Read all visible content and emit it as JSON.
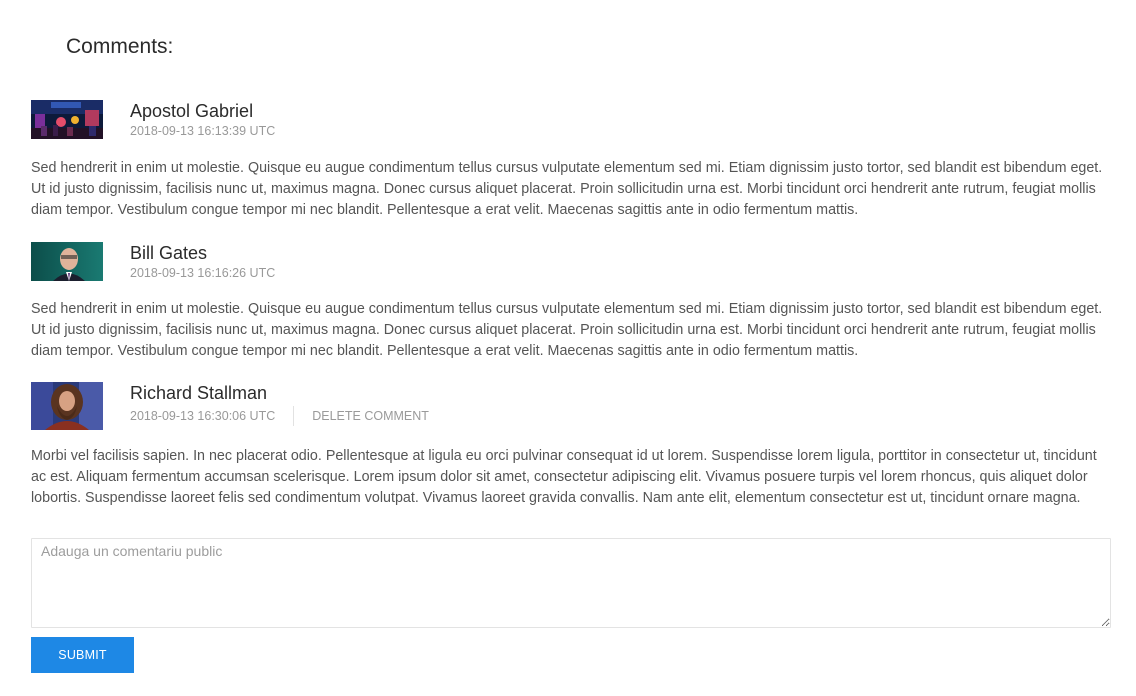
{
  "page": {
    "title": "Comments:"
  },
  "comments": [
    {
      "author": "Apostol Gabriel",
      "timestamp": "2018-09-13 16:13:39 UTC",
      "body": "Sed hendrerit in enim ut molestie. Quisque eu augue condimentum tellus cursus vulputate elementum sed mi. Etiam dignissim justo tortor, sed blandit est bibendum eget. Ut id justo dignissim, facilisis nunc ut, maximus magna. Donec cursus aliquet placerat. Proin sollicitudin urna est. Morbi tincidunt orci hendrerit ante rutrum, feugiat mollis diam tempor. Vestibulum congue tempor mi nec blandit. Pellentesque a erat velit. Maecenas sagittis ante in odio fermentum mattis.",
      "avatar_icon": "concert-stage-photo"
    },
    {
      "author": "Bill Gates",
      "timestamp": "2018-09-13 16:16:26 UTC",
      "body": "Sed hendrerit in enim ut molestie. Quisque eu augue condimentum tellus cursus vulputate elementum sed mi. Etiam dignissim justo tortor, sed blandit est bibendum eget. Ut id justo dignissim, facilisis nunc ut, maximus magna. Donec cursus aliquet placerat. Proin sollicitudin urna est. Morbi tincidunt orci hendrerit ante rutrum, feugiat mollis diam tempor. Vestibulum congue tempor mi nec blandit. Pellentesque a erat velit. Maecenas sagittis ante in odio fermentum mattis.",
      "avatar_icon": "portrait-photo"
    },
    {
      "author": "Richard Stallman",
      "timestamp": "2018-09-13 16:30:06 UTC",
      "delete_label": "DELETE COMMENT",
      "body": "Morbi vel facilisis sapien. In nec placerat odio. Pellentesque at ligula eu orci pulvinar consequat id ut lorem. Suspendisse lorem ligula, porttitor in consectetur ut, tincidunt ac est. Aliquam fermentum accumsan scelerisque. Lorem ipsum dolor sit amet, consectetur adipiscing elit. Vivamus posuere turpis vel lorem rhoncus, quis aliquet dolor lobortis. Suspendisse laoreet felis sed condimentum volutpat. Vivamus laoreet gravida convallis. Nam ante elit, elementum consectetur est ut, tincidunt ornare magna.",
      "avatar_icon": "portrait-photo"
    }
  ],
  "form": {
    "placeholder": "Adauga un comentariu public",
    "value": "",
    "submit_label": "SUBMIT"
  },
  "colors": {
    "accent": "#1e88e5",
    "muted_text": "#999999",
    "body_text": "#555555"
  }
}
